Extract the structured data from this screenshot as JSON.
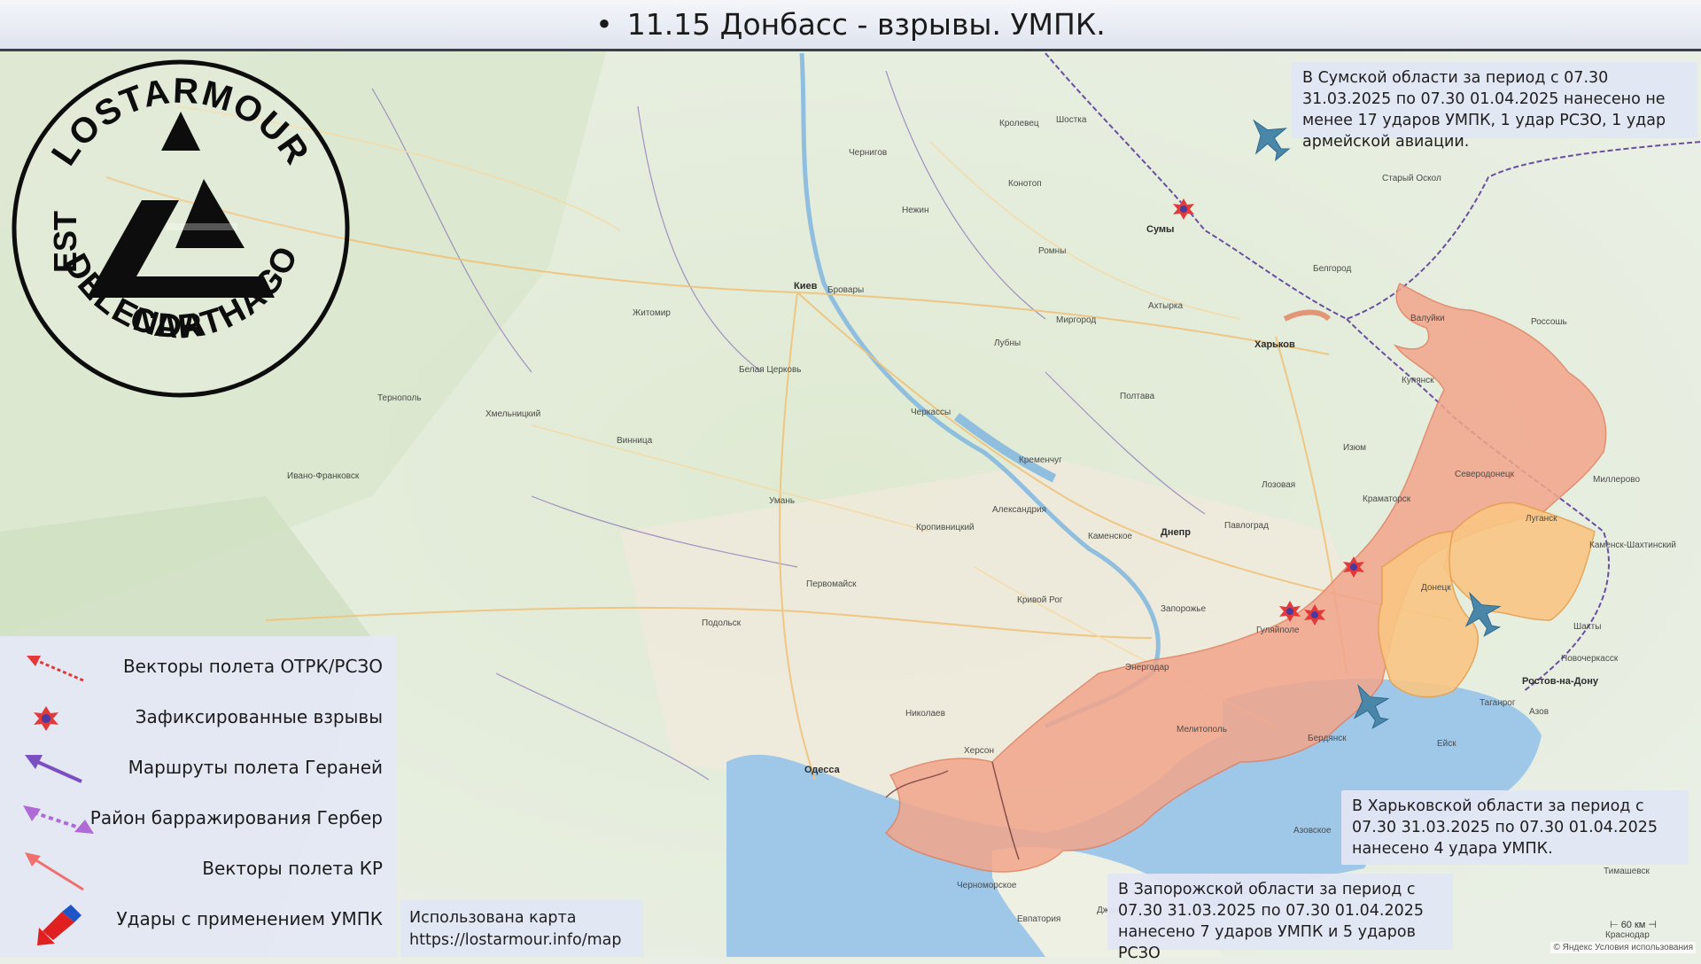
{
  "title": "11.15 Донбасс - взрывы. УМПК.",
  "info_boxes": {
    "sumy": "В Сумской области за период с 07.30 31.03.2025 по 07.30 01.04.2025 нанесено не менее 17 ударов УМПК, 1 удар РСЗО, 1 удар армейской авиации.",
    "kharkov": "В Харьковской области за период с 07.30 31.03.2025 по 07.30 01.04.2025 нанесено 4 удара УМПК.",
    "zaporozhye": "В Запорожской области за период с 07.30 31.03.2025 по 07.30 01.04.2025 нанесено 7 ударов УМПК и 5 ударов РСЗО"
  },
  "map_source": {
    "line1": "Использована карта",
    "line2": "https://lostarmour.info/map"
  },
  "legend": [
    {
      "label": "Векторы полета ОТРК/РСЗО",
      "icon": "dotted-red-arrow-icon"
    },
    {
      "label": "Зафиксированные взрывы",
      "icon": "explosion-icon"
    },
    {
      "label": "Маршруты полета Гераней",
      "icon": "purple-arrow-icon"
    },
    {
      "label": "Район барражирования Гербер",
      "icon": "purple-dotted-double-arrow-icon"
    },
    {
      "label": "Векторы полета КР",
      "icon": "red-line-arrow-icon"
    },
    {
      "label": "Удары с применением УМПК",
      "icon": "red-bomb-arrow-icon"
    }
  ],
  "logo": {
    "text_top": "LOSTARMOUR",
    "text_right": "CARTHAGO",
    "text_bottom": "DELENDA",
    "text_left": "EST"
  },
  "cities": {
    "kiev": "Киев",
    "brovary": "Бровары",
    "zhitomir": "Житомир",
    "chernigov": "Чернигов",
    "sumy": "Сумы",
    "kharkov": "Харьков",
    "belgorod": "Белгород",
    "poltava": "Полтава",
    "cherkassy": "Черкассы",
    "kremenchug": "Кременчуг",
    "vinnitsa": "Винница",
    "dnepr": "Днепр",
    "krivoy_rog": "Кривой Рог",
    "zaporozhye": "Запорожье",
    "nikolaev": "Николаев",
    "odessa": "Одесса",
    "kherson": "Херсон",
    "melitopol": "Мелитополь",
    "berdyansk": "Бердянск",
    "donetsk": "Донецк",
    "lugansk": "Луганск",
    "severodonetsk": "Северодонецк",
    "kramatorsk": "Краматорск",
    "izyum": "Изюм",
    "rostov": "Ростов-на-Дону",
    "taganrog": "Таганрог",
    "ternopol": "Тернополь",
    "khmelnitsky": "Хмельницкий",
    "ivano_frankovsk": "Ивано-Франковск",
    "belaya_tserkov": "Белая Церковь",
    "pavlograd": "Павлоград",
    "kamenskoe": "Каменское",
    "aleksandriya": "Александрия",
    "kropivnitsky": "Кропивницкий",
    "uman": "Умань",
    "gulyaipole": "Гуляйполе",
    "energodar": "Энергодар",
    "azov": "Азов",
    "shakhty": "Шахты",
    "novocherkassk": "Новочеркасск",
    "kamensk": "Каменск-Шахтинский",
    "millerovo": "Миллерово",
    "valuyki": "Валуйки",
    "rossosh": "Россошь",
    "stary_oskol": "Старый Оскол",
    "konotop": "Конотоп",
    "nezhin": "Нежин",
    "romny": "Ромны",
    "lubny": "Лубны",
    "mirgorod": "Миргород",
    "akhtyrka": "Ахтырка",
    "kupyansk": "Купянск",
    "lozovaya": "Лозовая",
    "pervomaisk": "Первомайск",
    "podolsk": "Подольск",
    "chernomorskoe": "Черноморское",
    "dzhankoy": "Джанкой",
    "evpatoriya": "Евпатория",
    "krasnodar": "Краснодар",
    "timashevsk": "Тимашевск",
    "eysk": "Ейск",
    "azov_sea": "Азовское",
    "sumy_region_town": "Шостка",
    "krolevets": "Кролевец"
  },
  "attribution": "© Яндекс Условия использования",
  "scale_label": "60 км",
  "colors": {
    "occupied_red": "#f3a58b",
    "occupied_orange": "#f9c684",
    "sea": "#9ec7e8",
    "land": "#e9efe4",
    "explosion": "#e23a3a",
    "jet": "#4a86a8",
    "legend_bg": "#e4e8f5"
  }
}
